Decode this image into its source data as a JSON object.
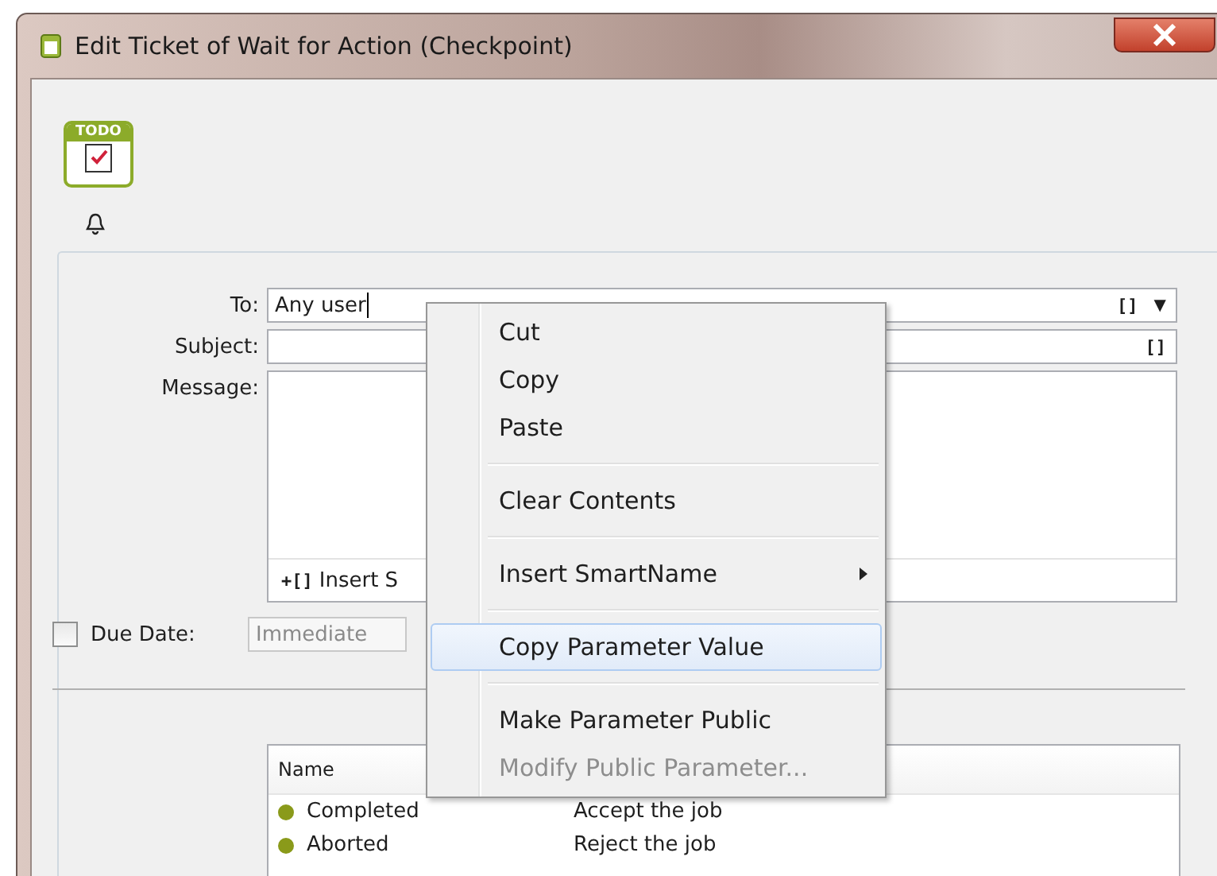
{
  "window": {
    "title": "Edit Ticket of Wait for Action (Checkpoint)"
  },
  "header": {
    "badge": "TODO"
  },
  "form": {
    "to": {
      "label": "To:",
      "value": "Any user",
      "glyph": "[]",
      "dropdown": "▼"
    },
    "subject": {
      "label": "Subject:",
      "glyph": "[]"
    },
    "message": {
      "label": "Message:",
      "insert_glyph": "+[]",
      "insert_text": "Insert S"
    },
    "due_date": {
      "label": "Due Date:",
      "checked": false,
      "placeholder": "Immediate"
    }
  },
  "table": {
    "columns": [
      "Name"
    ],
    "rows": [
      {
        "name": "Completed",
        "description": "Accept the job",
        "color": "#8a9a1a"
      },
      {
        "name": "Aborted",
        "description": "Reject the job",
        "color": "#8a9a1a"
      }
    ]
  },
  "context_menu": {
    "items": [
      {
        "kind": "item",
        "label": "Cut",
        "selected": false,
        "disabled": false,
        "submenu": false
      },
      {
        "kind": "item",
        "label": "Copy",
        "selected": false,
        "disabled": false,
        "submenu": false
      },
      {
        "kind": "item",
        "label": "Paste",
        "selected": false,
        "disabled": false,
        "submenu": false
      },
      {
        "kind": "separator"
      },
      {
        "kind": "item",
        "label": "Clear Contents",
        "selected": false,
        "disabled": false,
        "submenu": false
      },
      {
        "kind": "separator"
      },
      {
        "kind": "item",
        "label": "Insert SmartName",
        "selected": false,
        "disabled": false,
        "submenu": true
      },
      {
        "kind": "separator"
      },
      {
        "kind": "item",
        "label": "Copy Parameter Value",
        "selected": true,
        "disabled": false,
        "submenu": false
      },
      {
        "kind": "separator"
      },
      {
        "kind": "item",
        "label": "Make Parameter Public",
        "selected": false,
        "disabled": false,
        "submenu": false
      },
      {
        "kind": "item",
        "label": "Modify Public Parameter...",
        "selected": false,
        "disabled": true,
        "submenu": false
      }
    ]
  }
}
